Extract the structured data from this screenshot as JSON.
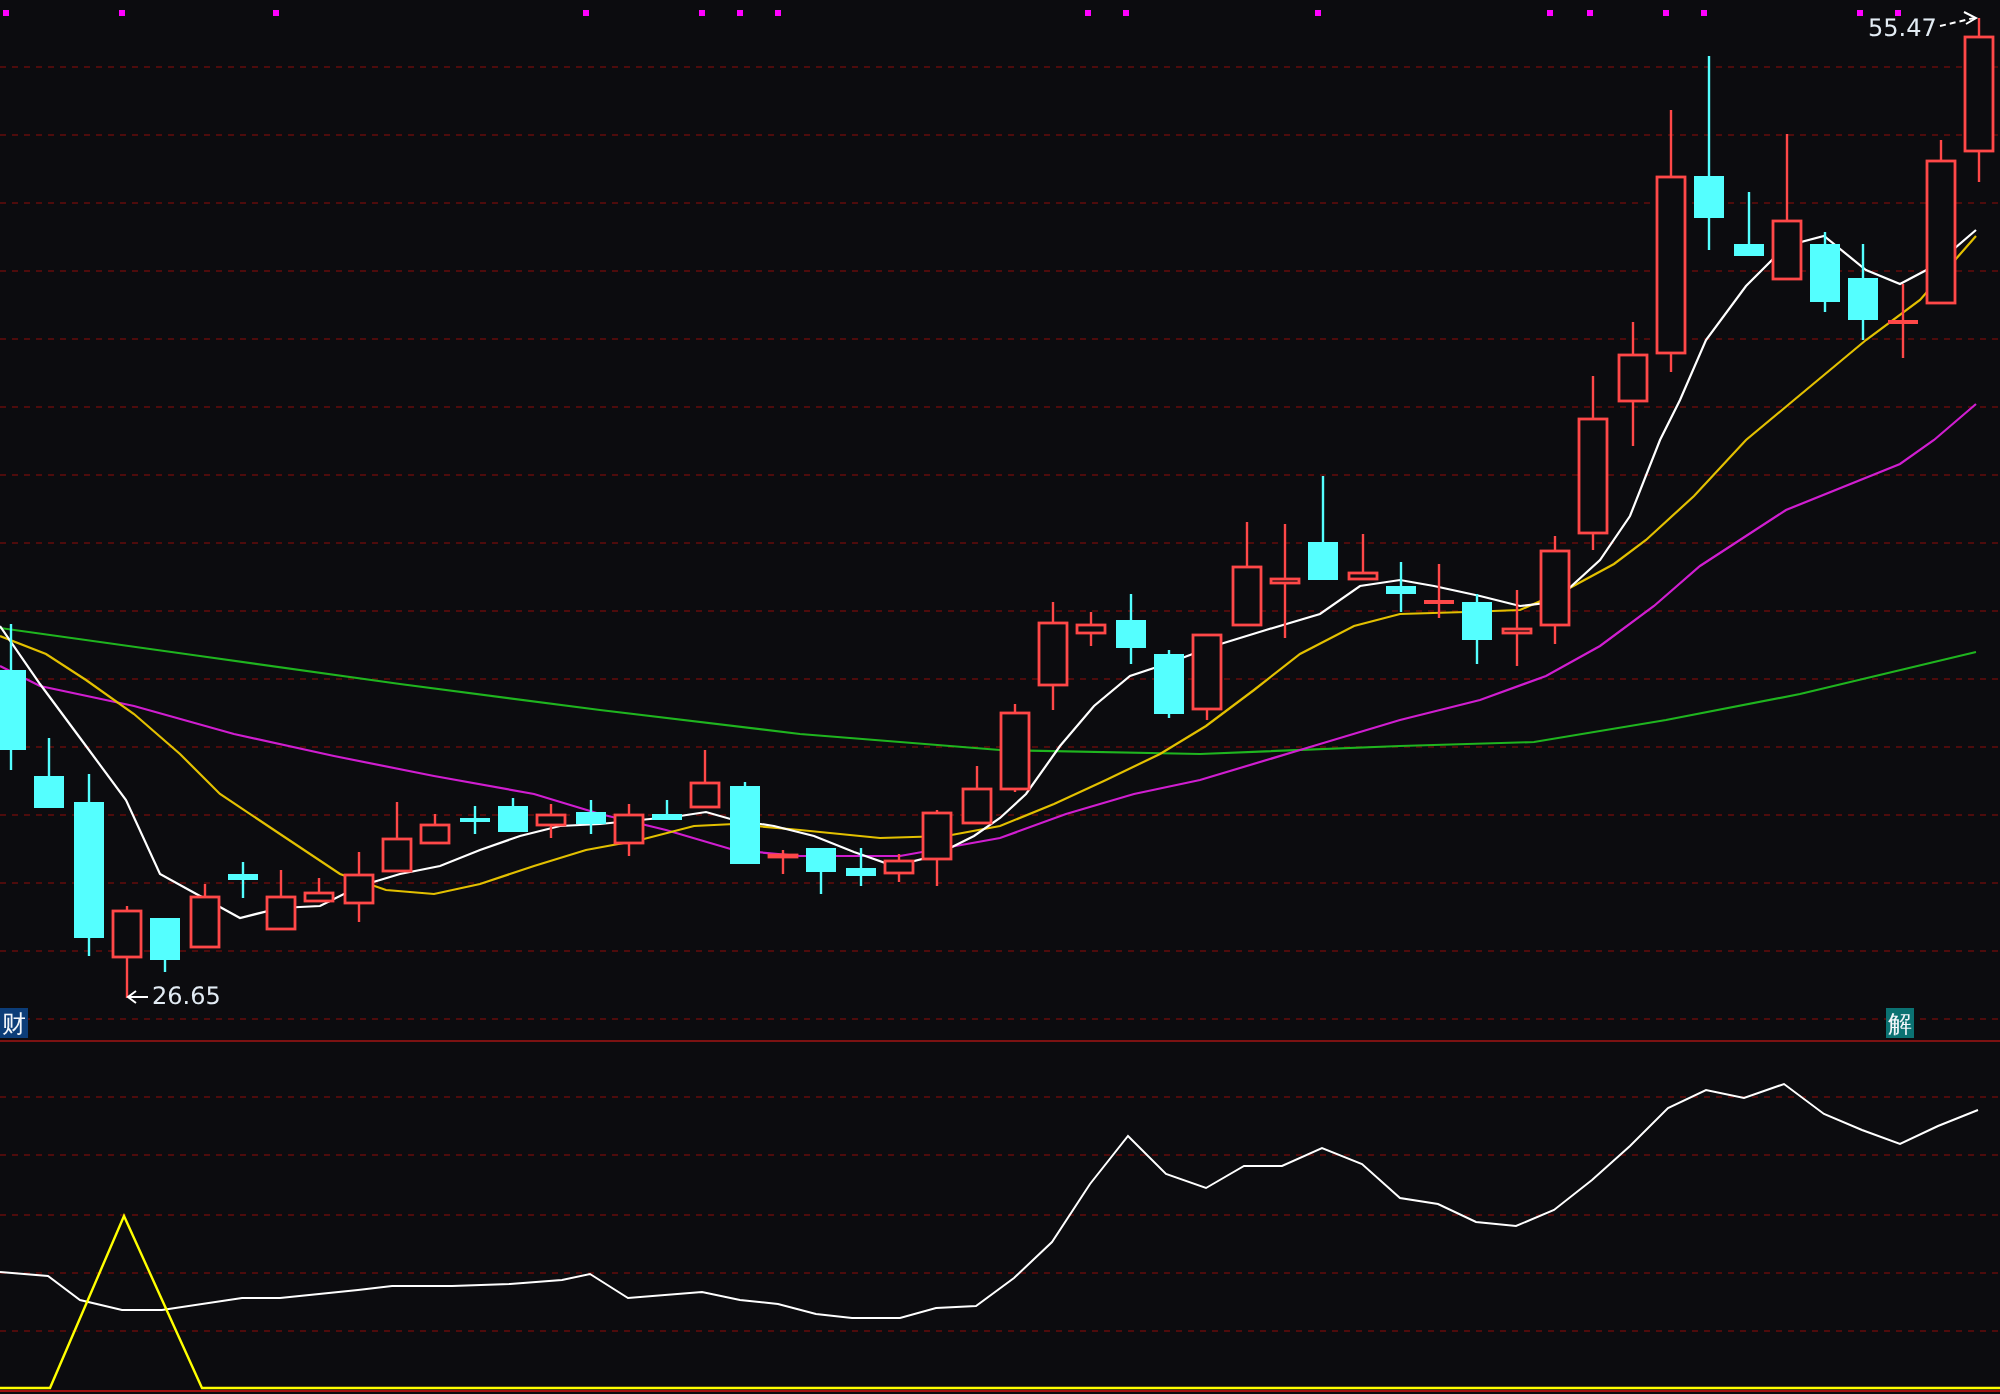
{
  "price_panel": {
    "high_label": "55.47",
    "low_label": "26.65",
    "tags": [
      {
        "text": "财",
        "color": "#0c3d78"
      },
      {
        "text": "解",
        "color": "#0b7272"
      }
    ]
  }
}
